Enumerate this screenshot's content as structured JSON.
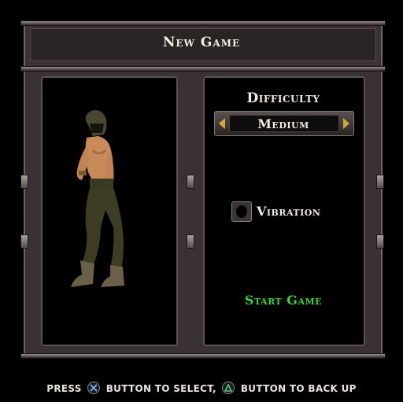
{
  "screen": {
    "title": "New Game"
  },
  "options": {
    "difficulty_label": "Difficulty",
    "difficulty_value": "Medium",
    "vibration_label": "Vibration",
    "vibration_enabled": false,
    "start_label": "Start Game"
  },
  "footer": {
    "press_text": "PRESS",
    "select_text": "BUTTON TO SELECT,",
    "back_text": "BUTTON TO BACK UP",
    "select_button_icon": "cross-button-icon",
    "back_button_icon": "triangle-button-icon"
  },
  "colors": {
    "accent_green": "#3bd43b",
    "text": "#f2ece2",
    "frame": "#3a3232"
  }
}
